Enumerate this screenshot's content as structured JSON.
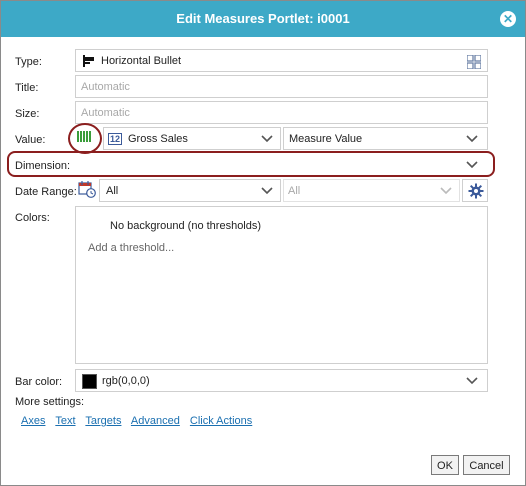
{
  "dialog": {
    "title": "Edit Measures Portlet: i0001",
    "close_icon": "close-icon"
  },
  "form": {
    "type_label": "Type:",
    "type_value": "Horizontal Bullet",
    "title_label": "Title:",
    "title_placeholder": "Automatic",
    "size_label": "Size:",
    "size_placeholder": "Automatic",
    "value_label": "Value:",
    "value_badge": "12",
    "value_measure": "Gross Sales",
    "value_kind": "Measure Value",
    "dimension_label": "Dimension:",
    "dimension_value": "",
    "date_range_label": "Date Range:",
    "date_range_value": "All",
    "date_range_value2": "All",
    "colors_label": "Colors:",
    "colors_no_background": "No background (no thresholds)",
    "colors_add_threshold": "Add a threshold...",
    "bar_color_label": "Bar color:",
    "bar_color_value": "rgb(0,0,0)",
    "bar_color_swatch": "#000000",
    "more_settings_label": "More settings:"
  },
  "more_settings_links": [
    "Axes",
    "Text",
    "Targets",
    "Advanced",
    "Click Actions"
  ],
  "buttons": {
    "ok": "OK",
    "cancel": "Cancel"
  },
  "colors": {
    "titlebar": "#3da9c7",
    "highlight": "#8b1e1e",
    "link": "#1a6fb0"
  }
}
